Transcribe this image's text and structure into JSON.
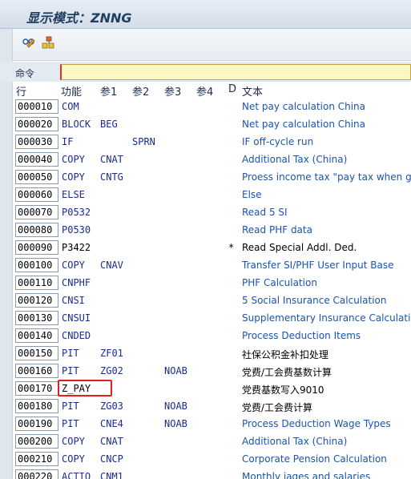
{
  "window": {
    "title": "显示模式：ZNNG"
  },
  "toolbar": {
    "buttons": [
      "display-change-icon",
      "structure-icon"
    ]
  },
  "command": {
    "label": "命令",
    "value": ""
  },
  "header": {
    "line": "行",
    "func": "功能",
    "p1": "参1",
    "p2": "参2",
    "p3": "参3",
    "p4": "参4",
    "d": "D",
    "text": "文本"
  },
  "rows": [
    {
      "seq": "000010",
      "func": "COM",
      "p1": "",
      "p2": "",
      "p3": "",
      "d": "",
      "text": "Net pay calculation China"
    },
    {
      "seq": "000020",
      "func": "BLOCK",
      "p1": "BEG",
      "p2": "",
      "p3": "",
      "d": "",
      "text": "Net pay calculation China"
    },
    {
      "seq": "000030",
      "func": "IF",
      "p1": "",
      "p2": "SPRN",
      "p3": "",
      "d": "",
      "text": "IF off-cycle run"
    },
    {
      "seq": "000040",
      "func": "COPY",
      "p1": "CNAT",
      "p2": "",
      "p3": "",
      "d": "",
      "text": "Additional Tax (China)"
    },
    {
      "seq": "000050",
      "func": "COPY",
      "p1": "CNTG",
      "p2": "",
      "p3": "",
      "d": "",
      "text": "Proess income tax \"pay tax when get\""
    },
    {
      "seq": "000060",
      "func": "ELSE",
      "p1": "",
      "p2": "",
      "p3": "",
      "d": "",
      "text": "Else"
    },
    {
      "seq": "000070",
      "func": "P0532",
      "p1": "",
      "p2": "",
      "p3": "",
      "d": "",
      "text": "Read 5 SI"
    },
    {
      "seq": "000080",
      "func": "P0530",
      "p1": "",
      "p2": "",
      "p3": "",
      "d": "",
      "text": "Read PHF data"
    },
    {
      "seq": "000090",
      "func": "P3422",
      "p1": "",
      "p2": "",
      "p3": "",
      "d": "*",
      "text": "Read Special Addl. Ded."
    },
    {
      "seq": "000100",
      "func": "COPY",
      "p1": "CNAV",
      "p2": "",
      "p3": "",
      "d": "",
      "text": "Transfer SI/PHF User Input Base"
    },
    {
      "seq": "000110",
      "func": "CNPHF",
      "p1": "",
      "p2": "",
      "p3": "",
      "d": "",
      "text": "PHF Calculation"
    },
    {
      "seq": "000120",
      "func": "CNSI",
      "p1": "",
      "p2": "",
      "p3": "",
      "d": "",
      "text": "5 Social Insurance Calculation"
    },
    {
      "seq": "000130",
      "func": "CNSUI",
      "p1": "",
      "p2": "",
      "p3": "",
      "d": "",
      "text": "Supplementary Insurance Calculation"
    },
    {
      "seq": "000140",
      "func": "CNDED",
      "p1": "",
      "p2": "",
      "p3": "",
      "d": "",
      "text": "Process Deduction Items"
    },
    {
      "seq": "000150",
      "func": "PIT",
      "p1": "ZF01",
      "p2": "",
      "p3": "",
      "d": "",
      "text": "社保公积金补扣处理"
    },
    {
      "seq": "000160",
      "func": "PIT",
      "p1": "ZG02",
      "p2": "",
      "p3": "NOAB",
      "d": "",
      "text": "党费/工会费基数计算"
    },
    {
      "seq": "000170",
      "func": "Z_PAY",
      "p1": "",
      "p2": "",
      "p3": "",
      "d": "",
      "text": "党费基数写入9010"
    },
    {
      "seq": "000180",
      "func": "PIT",
      "p1": "ZG03",
      "p2": "",
      "p3": "NOAB",
      "d": "",
      "text": "党费/工会费计算"
    },
    {
      "seq": "000190",
      "func": "PIT",
      "p1": "CNE4",
      "p2": "",
      "p3": "NOAB",
      "d": "",
      "text": "Process Deduction Wage Types"
    },
    {
      "seq": "000200",
      "func": "COPY",
      "p1": "CNAT",
      "p2": "",
      "p3": "",
      "d": "",
      "text": "Additional Tax (China)"
    },
    {
      "seq": "000210",
      "func": "COPY",
      "p1": "CNCP",
      "p2": "",
      "p3": "",
      "d": "",
      "text": "Corporate Pension Calculation"
    },
    {
      "seq": "000220",
      "func": "ACTIO",
      "p1": "CNM1",
      "p2": "",
      "p3": "",
      "d": "",
      "text": "Monthly iages and salaries"
    }
  ],
  "colors": {
    "highlight": "#e0211b",
    "text_link": "#1b54a8",
    "command_bg": "#fdf7c6"
  }
}
